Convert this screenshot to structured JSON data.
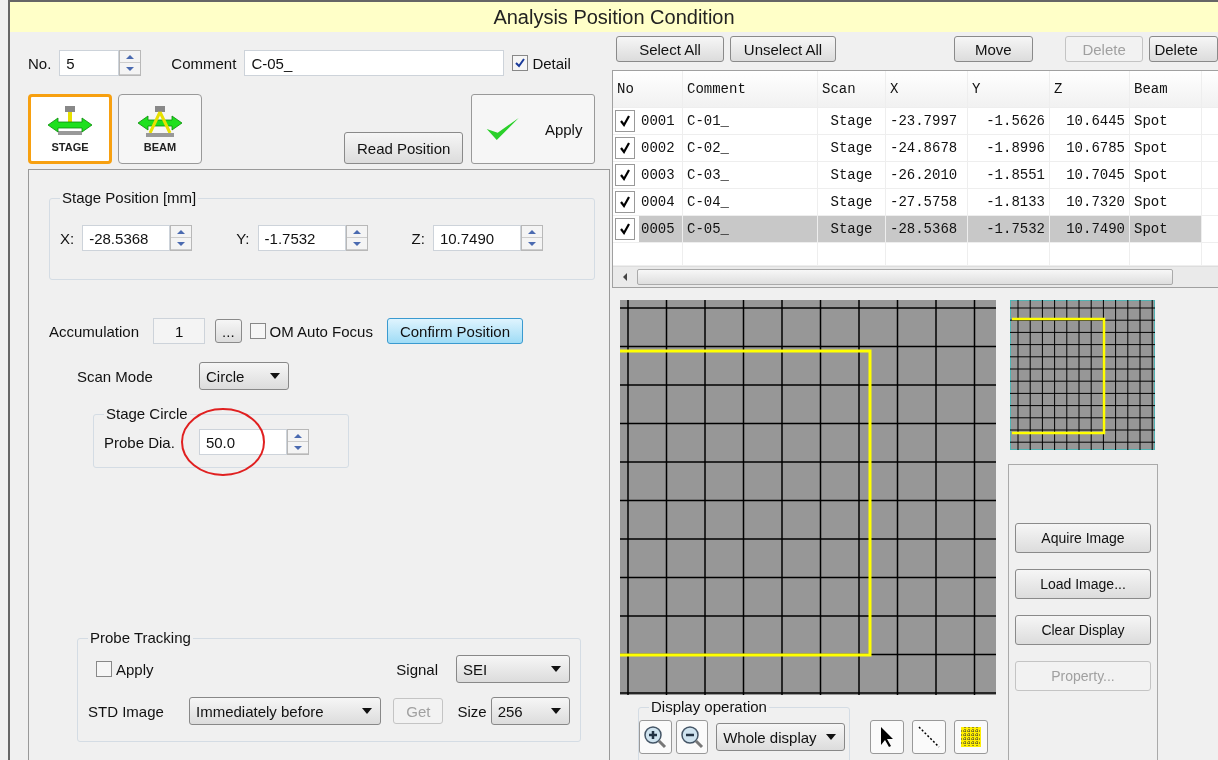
{
  "window": {
    "title": "Analysis Position Condition"
  },
  "header": {
    "no_label": "No.",
    "no_value": "5",
    "comment_label": "Comment",
    "comment_value": "C-05_",
    "detail": {
      "label": "Detail",
      "checked": true
    }
  },
  "mode_tabs": [
    {
      "label": "STAGE",
      "kind": "stage",
      "selected": true
    },
    {
      "label": "BEAM",
      "kind": "beam",
      "selected": false
    }
  ],
  "read_position_button": "Read Position",
  "apply_button": "Apply",
  "stage_position": {
    "title": "Stage Position [mm]",
    "fields": [
      {
        "label": "X:",
        "value": "-28.5368"
      },
      {
        "label": "Y:",
        "value": "-1.7532"
      },
      {
        "label": "Z:",
        "value": "10.7490"
      }
    ]
  },
  "accumulation": {
    "label": "Accumulation",
    "value": "1",
    "more_button": "...",
    "om_auto_focus": {
      "label": "OM Auto Focus",
      "checked": false
    },
    "confirm_button": "Confirm Position"
  },
  "scan_mode": {
    "label": "Scan Mode",
    "value": "Circle"
  },
  "stage_circle": {
    "title": "Stage Circle",
    "label": "Probe Dia.",
    "value": "50.0",
    "highlighted": true
  },
  "probe_tracking": {
    "title": "Probe Tracking",
    "apply": {
      "label": "Apply",
      "checked": false
    },
    "signal_label": "Signal",
    "signal_value": "SEI",
    "std_image_label": "STD Image",
    "std_image_value": "Immediately before",
    "get_button": {
      "label": "Get",
      "disabled": true
    },
    "size_label": "Size",
    "size_value": "256"
  },
  "toolbar": [
    {
      "label": "Select All",
      "disabled": false
    },
    {
      "label": "Unselect All",
      "disabled": false
    },
    {
      "label": "Move",
      "disabled": false
    },
    {
      "label": "Delete",
      "disabled": true
    },
    {
      "label": "Delete",
      "disabled": false
    }
  ],
  "table": {
    "columns": [
      "No",
      "Comment",
      "Scan",
      "X",
      "Y",
      "Z",
      "Beam"
    ],
    "rows": [
      {
        "checked": true,
        "selected": false,
        "cells": [
          "0001",
          "C-01_",
          "Stage",
          "-23.7997",
          "-1.5626",
          "10.6445",
          "Spot"
        ]
      },
      {
        "checked": true,
        "selected": false,
        "cells": [
          "0002",
          "C-02_",
          "Stage",
          "-24.8678",
          "-1.8996",
          "10.6785",
          "Spot"
        ]
      },
      {
        "checked": true,
        "selected": false,
        "cells": [
          "0003",
          "C-03_",
          "Stage",
          "-26.2010",
          "-1.8551",
          "10.7045",
          "Spot"
        ]
      },
      {
        "checked": true,
        "selected": false,
        "cells": [
          "0004",
          "C-04_",
          "Stage",
          "-27.5758",
          "-1.8133",
          "10.7320",
          "Spot"
        ]
      },
      {
        "checked": true,
        "selected": true,
        "cells": [
          "0005",
          "C-05_",
          "Stage",
          "-28.5368",
          "-1.7532",
          "10.7490",
          "Spot"
        ]
      }
    ]
  },
  "image_buttons": [
    {
      "label": "Aquire Image",
      "disabled": false
    },
    {
      "label": "Load Image...",
      "disabled": false
    },
    {
      "label": "Clear Display",
      "disabled": false
    },
    {
      "label": "Property...",
      "disabled": true
    }
  ],
  "display_operation": {
    "title": "Display operation",
    "zoom_value": "Whole display"
  }
}
